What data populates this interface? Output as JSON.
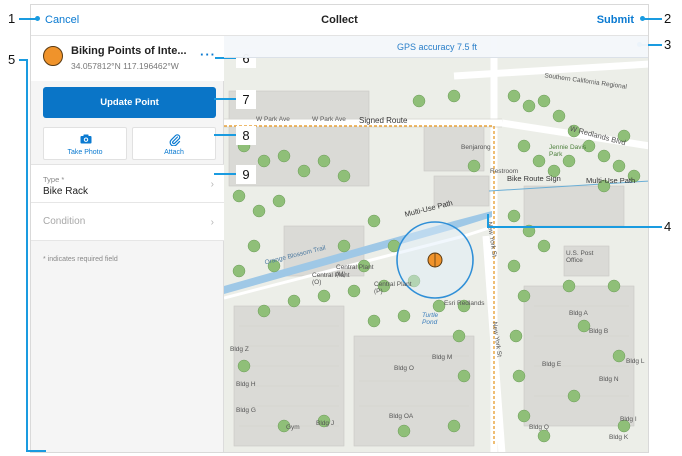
{
  "topbar": {
    "cancel_label": "Cancel",
    "title": "Collect",
    "submit_label": "Submit"
  },
  "feature": {
    "name": "Biking Points of Inte...",
    "coordinates": "34.057812°N  117.196462°W",
    "more_icon": "more-horizontal-icon"
  },
  "actions": {
    "update_label": "Update Point",
    "take_photo_label": "Take Photo",
    "attach_label": "Attach"
  },
  "fields": [
    {
      "label": "Type *",
      "value": "Bike Rack"
    },
    {
      "label": "",
      "placeholder": "Condition"
    }
  ],
  "required_note": "* indicates required field",
  "map": {
    "gps_accuracy": "GPS accuracy 7.5 ft",
    "labels": {
      "w_park_ave_1": "W Park Ave",
      "w_park_ave_2": "W Park Ave",
      "signed_route": "Signed Route",
      "southern_ca_regional": "Southern California Regional",
      "w_redlands_blvd": "W Redlands Blvd",
      "jennie_davis": "Jennie Davis Park",
      "benjarong": "Benjarong",
      "restroom": "Restroom",
      "bike_route_sign": "Bike Route Sign",
      "multi_use_path_1": "Multi-Use Path",
      "multi_use_path_2": "Multi-Use Path",
      "orange_blossom": "Orange Blossom Trail",
      "central_plant_m": "Central Plant (M)",
      "central_plant_o": "Central Plant (O)",
      "central_plant_p": "Central Plant (P)",
      "new_york_st_1": "New York St",
      "new_york_st_2": "New York St",
      "esri_redlands": "Esri Redlands",
      "turtle_pond": "Turtle Pond",
      "us_post_office": "U.S. Post Office",
      "bldg_a": "Bldg A",
      "bldg_b": "Bldg B",
      "bldg_e": "Bldg E",
      "bldg_l": "Bldg L",
      "bldg_m": "Bldg M",
      "bldg_n": "Bldg N",
      "bldg_o": "Bldg O",
      "bldg_oa": "Bldg OA",
      "bldg_q": "Bldg Q",
      "bldg_z": "Bldg Z",
      "bldg_h": "Bldg H",
      "bldg_g": "Bldg G",
      "bldg_j": "Bldg J",
      "bldg_i": "Bldg I",
      "bldg_k": "Bldg K",
      "gym": "Gym"
    }
  },
  "callouts": [
    "1",
    "2",
    "3",
    "4",
    "5",
    "6",
    "7",
    "8",
    "9"
  ],
  "colors": {
    "accent": "#0a7ad1",
    "button": "#0a75c7",
    "feature_point": "#f0932b",
    "callout_line": "#1a9be0"
  }
}
